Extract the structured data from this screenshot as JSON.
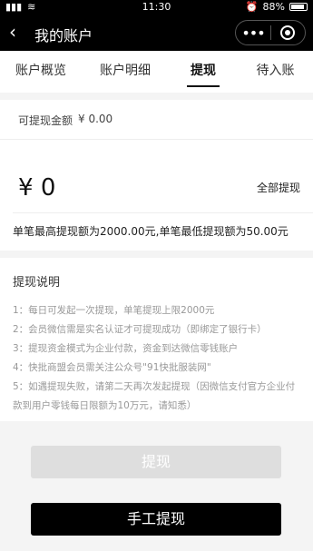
{
  "status_bar": {
    "time": "11:30",
    "battery": "88%"
  },
  "nav": {
    "title": "我的账户",
    "back_icon": "chevron-left-icon",
    "more_icon": "more-dots-icon",
    "close_icon": "target-ring-icon"
  },
  "tabs": [
    {
      "label": "账户概览",
      "active": false
    },
    {
      "label": "账户明细",
      "active": false
    },
    {
      "label": "提现",
      "active": true
    },
    {
      "label": "待入账",
      "active": false
    }
  ],
  "balance": {
    "label": "可提现金额",
    "value": "¥ 0.00"
  },
  "input": {
    "currency": "¥",
    "amount": "0",
    "all_label": "全部提现"
  },
  "limit_note": "单笔最高提现额为2000.00元,单笔最低提现额为50.00元",
  "instructions": {
    "title": "提现说明",
    "items": [
      "1：每日可发起一次提现，单笔提现上限2000元",
      "2：会员微信需是实名认证才可提现成功（即绑定了银行卡）",
      "3：提现资金模式为企业付款，资金到达微信零钱账户",
      "4：快批商盟会员需关注公众号\"91快批服装网\"",
      "5：如遇提现失败，请第二天再次发起提现（因微信支付官方企业付款到用户零钱每日限额为10万元，请知悉）"
    ]
  },
  "buttons": {
    "withdraw": "提现",
    "manual_withdraw": "手工提现"
  },
  "colors": {
    "nav_bg": "#000000",
    "primary_button": "#000000",
    "disabled_button": "#dedede"
  }
}
